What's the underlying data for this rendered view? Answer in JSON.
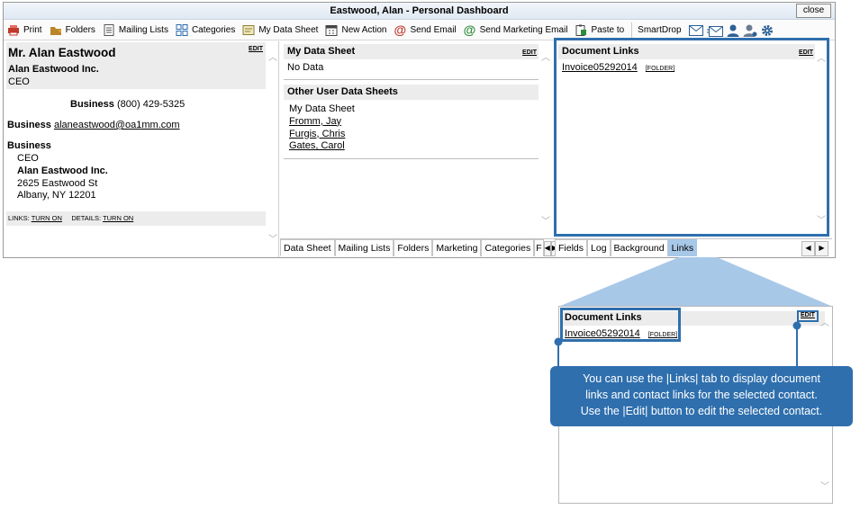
{
  "window": {
    "title": "Eastwood, Alan - Personal Dashboard",
    "close_label": "close"
  },
  "toolbar": {
    "items": [
      {
        "label": "Print",
        "icon": "printer-icon",
        "color": "#c0392b"
      },
      {
        "label": "Folders",
        "icon": "folder-icon",
        "color": "#b8862b"
      },
      {
        "label": "Mailing Lists",
        "icon": "list-icon",
        "color": "#555555"
      },
      {
        "label": "Categories",
        "icon": "grid-icon",
        "color": "#2b6cb0"
      },
      {
        "label": "My Data Sheet",
        "icon": "datasheet-icon",
        "color": "#8b7d3a"
      },
      {
        "label": "New Action",
        "icon": "calendar-icon",
        "color": "#444444"
      },
      {
        "label": "Send Email",
        "icon": "at-red-icon",
        "color": "#c0392b"
      },
      {
        "label": "Send Marketing Email",
        "icon": "at-green-icon",
        "color": "#2e8b3a"
      },
      {
        "label": "Paste to",
        "icon": "clipboard-icon",
        "color": "#2e8b3a"
      },
      {
        "label": "SmartDrop"
      }
    ],
    "extra_icons": [
      "envelope-icon",
      "envelope-send-icon",
      "user-icon",
      "user-gray-icon",
      "gear-icon"
    ]
  },
  "contact": {
    "name": "Mr. Alan Eastwood",
    "edit_label": "EDIT",
    "company": "Alan Eastwood Inc.",
    "title": "CEO",
    "phone_label": "Business",
    "phone": "(800) 429-5325",
    "email_label": "Business",
    "email": "alaneastwood@oa1mm.com",
    "address_label": "Business",
    "address_title": "CEO",
    "address_company": "Alan Eastwood Inc.",
    "street": "2625 Eastwood St",
    "city": "Albany, NY 12201",
    "links_label": "LINKS:",
    "links_action": "TURN ON",
    "details_label": "DETAILS:",
    "details_action": "TURN ON"
  },
  "datasheet": {
    "heading": "My Data Sheet",
    "edit_label": "EDIT",
    "value": "No Data",
    "other_heading": "Other User Data Sheets",
    "others": [
      "My Data Sheet",
      "Fromm, Jay",
      "Furgis, Chris",
      "Gates, Carol"
    ]
  },
  "middle_tabs": [
    "Data Sheet",
    "Mailing Lists",
    "Folders",
    "Marketing",
    "Categories",
    "F"
  ],
  "right_tabs": [
    "Fields",
    "Log",
    "Background",
    "Links"
  ],
  "doclinks": {
    "heading": "Document Links",
    "edit_label": "EDIT",
    "link": "Invoice05292014",
    "folder": "[FOLDER]"
  },
  "callout": {
    "text_line1": "You can use the |Links| tab to display document",
    "text_line2": "links and contact links for the selected contact.",
    "text_line3": "Use the |Edit| button to edit the selected contact.",
    "accent": "#2f6fad",
    "highlight": "#a8c8e8"
  }
}
